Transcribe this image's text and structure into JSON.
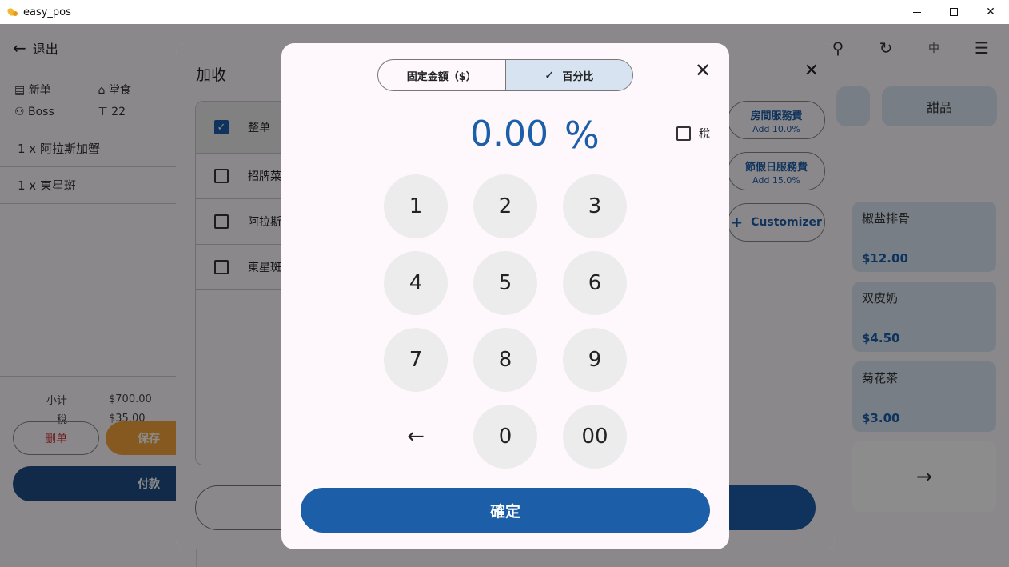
{
  "window": {
    "title": "easy_pos"
  },
  "app": {
    "back_label": "退出",
    "lang_label": "中",
    "order_meta": {
      "order_type": "新单",
      "dine_mode": "堂食",
      "user": "Boss",
      "table": "22"
    },
    "order_lines": [
      "1  x 阿拉斯加蟹",
      "1  x 東星斑"
    ],
    "totals": [
      {
        "label": "小计",
        "value": "$700.00"
      },
      {
        "label": "稅",
        "value": "$35.00"
      }
    ],
    "actions": {
      "delete": "删单",
      "save": "保存",
      "pay": "付款"
    },
    "category_tab": "甜品",
    "products": [
      {
        "name": "椒盐排骨",
        "price": "$12.00"
      },
      {
        "name": "双皮奶",
        "price": "$4.50"
      },
      {
        "name": "菊花茶",
        "price": "$3.00"
      }
    ]
  },
  "surcharge_modal": {
    "title": "加收",
    "items": [
      {
        "label": "整单",
        "checked": true
      },
      {
        "label": "招牌菜",
        "checked": false
      },
      {
        "label": "阿拉斯",
        "checked": false
      },
      {
        "label": "東星斑",
        "checked": false
      }
    ],
    "presets": [
      {
        "name": "房間服務費",
        "detail": "Add 10.0%"
      },
      {
        "name": "節假日服務費",
        "detail": "Add 15.0%"
      }
    ],
    "custom_label": "Customizer"
  },
  "keypad_modal": {
    "mode_fixed": "固定金額（$）",
    "mode_percent": "百分比",
    "active_mode": "percent",
    "value": "0.00",
    "unit": "%",
    "tax_label": "稅",
    "tax_checked": false,
    "keys": [
      "1",
      "2",
      "3",
      "4",
      "5",
      "6",
      "7",
      "8",
      "9",
      "0",
      "00"
    ],
    "confirm": "確定",
    "colors": {
      "primary": "#1c5ea8",
      "active_segment": "#d7e3f1",
      "key_bg": "#ececec"
    }
  }
}
